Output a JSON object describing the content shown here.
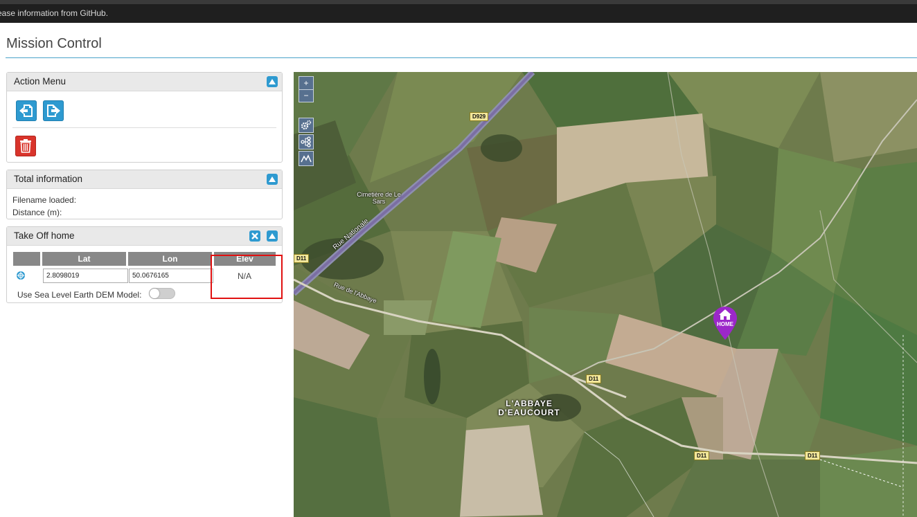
{
  "notice": {
    "text": "ease information from GitHub."
  },
  "page": {
    "title": "Mission Control"
  },
  "action_menu": {
    "title": "Action Menu",
    "buttons": [
      "import-icon",
      "export-icon",
      "trash-icon"
    ]
  },
  "total_info": {
    "title": "Total information",
    "filename_label": "Filename loaded:",
    "distance_label": "Distance (m):"
  },
  "takeoff": {
    "title": "Take Off home",
    "headers": {
      "lat": "Lat",
      "lon": "Lon",
      "elev": "Elev"
    },
    "lat_value": "2.8098019",
    "lon_value": "50.0676165",
    "elev_value": "N/A",
    "dem_label": "Use Sea Level Earth DEM Model:",
    "dem_enabled": false
  },
  "map": {
    "zoom_in": "+",
    "zoom_out": "−",
    "roads": [
      "D929",
      "D11",
      "D11",
      "D11",
      "D11"
    ],
    "places": {
      "cemetery": "Cimetière de Le Sars",
      "rue_nationale": "Rue Nationale",
      "rue_abbaye": "Rue de l'Abbaye",
      "town_line1": "L'ABBAYE",
      "town_line2": "D'EAUCOURT"
    },
    "home_marker": "HOME"
  },
  "colors": {
    "accent": "#2e9ad0",
    "danger": "#d9342b",
    "marker": "#9b27c9",
    "highlight": "#e01010"
  }
}
